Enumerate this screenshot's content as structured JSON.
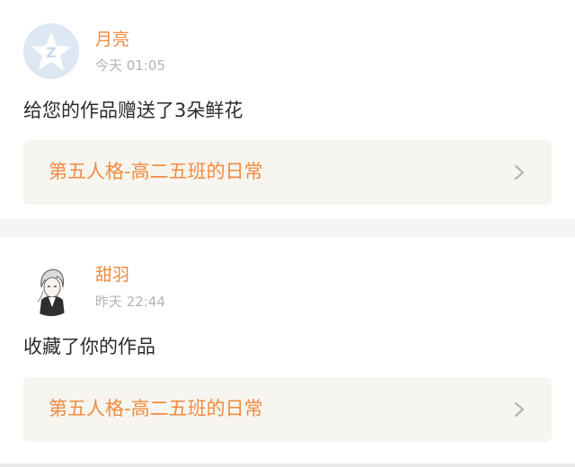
{
  "notifications": [
    {
      "username": "月亮",
      "timestamp": "今天 01:05",
      "message": "给您的作品赠送了3朵鲜花",
      "work_title": "第五人格-高二五班的日常",
      "avatar_icon": "default-avatar-icon"
    },
    {
      "username": "甜羽",
      "timestamp": "昨天 22:44",
      "message": "收藏了你的作品",
      "work_title": "第五人格-高二五班的日常",
      "avatar_icon": "anime-character-avatar"
    }
  ],
  "colors": {
    "accent": "#f28a3f",
    "timestamp": "#b3b3b3",
    "text": "#2b2b2b",
    "link_bg": "#f6f5f0",
    "separator": "#f4f4f4"
  }
}
